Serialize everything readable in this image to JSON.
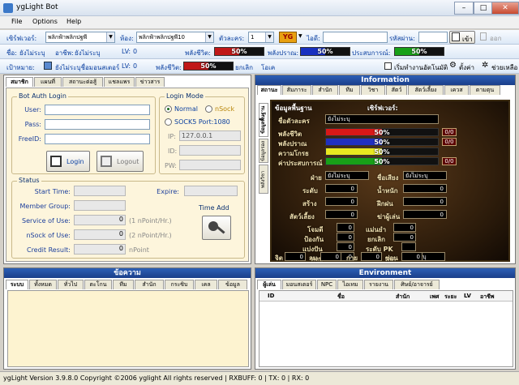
{
  "window": {
    "title": "ygLight Bot"
  },
  "menu": [
    "File",
    "Options",
    "Help"
  ],
  "toolbar1": {
    "server_label": "เซิร์ฟเวอร์:",
    "server_value": "พลิกฟ้าพลิกปฐพี",
    "room_label": "ห้อง:",
    "room_value": "พลิกฟ้าพลิกปฐพี10",
    "char_label": "ตัวละคร:",
    "char_value": "1",
    "yg_logo": "YG",
    "id_label": "ไอดี:",
    "id_value": "",
    "pass_label": "รหัสผ่าน:",
    "pass_value": "",
    "login_label": "เข้า",
    "logout_label": "ออก"
  },
  "toolbar2": {
    "name_label": "ชื่อ:",
    "name_value": "ยังไม่ระบุ",
    "job_label": "อาชีพ:",
    "job_value": "ยังไม่ระบุ",
    "lv_label": "LV:",
    "lv_value": "0",
    "hp_label": "พลังชีวิต:",
    "hp_text": "50%",
    "hp_percent": 50,
    "mp_label": "พลังปราณ:",
    "mp_text": "50%",
    "mp_percent": 50,
    "exp_label": "ประสบการณ์:",
    "exp_text": "50%",
    "exp_percent": 50
  },
  "toolbar3": {
    "target_label": "เป้าหมาย:",
    "target_value": "ยังไม่ระบุชื่อมอนสเตอร์",
    "lv_label": "LV:",
    "lv_value": "0",
    "hp_label": "พลังชีวิต:",
    "hp_text": "50%",
    "hp_percent": 50,
    "cancel_label": "ยกเลิก",
    "auto_label": "โอเค",
    "start_label": "เริ่มทำงานอัตโนมัติ",
    "settings_label": "ตั้งค่า",
    "help_label": "ช่วยเหลือ"
  },
  "left_tabs": [
    "สมาชิก",
    "แผนที่",
    "สถานะต่อสู้",
    "แชลแพร",
    "ข่าวสาร"
  ],
  "bot_auth": {
    "title": "Bot Auth Login",
    "user_label": "User:",
    "pass_label": "Pass:",
    "freeid_label": "FreeID:",
    "login_btn": "Login",
    "logout_btn": "Logout"
  },
  "login_mode": {
    "title": "Login Mode",
    "normal": "Normal",
    "nsock": "nSock",
    "socks5": "SOCK5  Port:1080",
    "ip_label": "IP:",
    "ip_value": "127.0.0.1",
    "id_label": "ID:",
    "pw_label": "PW:"
  },
  "status": {
    "title": "Status",
    "start_label": "Start Time:",
    "expire_label": "Expire:",
    "group_label": "Member Group:",
    "service_label": "Service of Use:",
    "service_value": "0",
    "service_hint": "(1 nPoint/Hr.)",
    "nsock_label": "nSock of Use:",
    "nsock_value": "0",
    "nsock_hint": "(2 nPoint/Hr.)",
    "credit_label": "Credit Result:",
    "credit_value": "0",
    "credit_unit": "nPoint",
    "timeadd_label": "Time Add"
  },
  "info": {
    "header": "Information",
    "tabs": [
      "สถานะ",
      "สัมภาระ",
      "สำนัก",
      "ทีม",
      "วิชา",
      "สัตว์",
      "สัตว์เลี้ยง",
      "เควส",
      "ตามตุน"
    ],
    "side_tabs": [
      "ข้อมูลพื้นฐาน",
      "ข้อมูลรอง",
      "พลังวิชา"
    ],
    "panel_title": "ข้อมูลพื้นฐาน",
    "server_label": "เซิร์ฟเวอร์:",
    "char_name_label": "ชื่อตัวละคร",
    "char_name_value": "ยังไม่ระบุ",
    "bars": [
      {
        "label": "พลังชีวิต",
        "text": "50%",
        "percent": 50,
        "color": "#d81818",
        "count": "0/0"
      },
      {
        "label": "พลังปราณ",
        "text": "50%",
        "percent": 50,
        "color": "#2030c0",
        "count": "0/0"
      },
      {
        "label": "ความโกรธ",
        "text": "50%",
        "percent": 50,
        "color": "#e8e820",
        "count": ""
      },
      {
        "label": "ค่าประสบการณ์",
        "text": "50%",
        "percent": 50,
        "color": "#18a018",
        "count": "0/0"
      }
    ],
    "faction_label": "ฝ่าย",
    "faction_value": "ยังไม่ระบุ",
    "title_label": "ชื่อเสียง",
    "title_value": "ยังไม่ระบุ",
    "level_label": "ระดับ",
    "level_value": "0",
    "weight_label": "น้ำหนัก",
    "weight_value": "0",
    "str_label": "สร้าง",
    "str_value": "0",
    "skill_label": "ฝีกฝน",
    "skill_value": "0",
    "merit_label": "สัตว์เลี้ยง",
    "merit_value": "0",
    "kill_label": "ฆ่าผู้เล่น",
    "kill_value": "0",
    "atk_label": "โจมตี",
    "atk_value": "0",
    "def_label": "ป้องกัน",
    "def_value": "0",
    "dodge_label": "หลบ",
    "dodge_value": "0",
    "hit_label": "แม่นยำ",
    "hit_value": "0",
    "gold_label": "แบ่งปัน",
    "gold_value": "0",
    "crit_label": "ยกเลิก",
    "crit_value": "0",
    "pk_label": "ระดับ PK",
    "pk_value": "",
    "sex_label": "เพศ",
    "sex_value": "ยังไม่ระบุ",
    "bottom": [
      {
        "label": "จิต",
        "value": "0"
      },
      {
        "label": "ลม",
        "value": "0"
      },
      {
        "label": "กาย",
        "value": "0"
      },
      {
        "label": "ซ่อน",
        "value": "0"
      }
    ]
  },
  "messages": {
    "header": "ข้อความ",
    "tabs": [
      "ระบบ",
      "ทั้งหมด",
      "ทั่วไป",
      "ตะโกน",
      "ทีม",
      "สำนัก",
      "กระซิบ",
      "เคล",
      "ข้อมูล"
    ]
  },
  "environment": {
    "header": "Environment",
    "tabs": [
      "ผู้เล่น",
      "มอนสเตอร์",
      "NPC",
      "ไอเทม",
      "รายงาน",
      "ศิษย์/อาจารย์"
    ],
    "columns": [
      "ID",
      "ชื่อ",
      "สำนัก",
      "เพศ",
      "ระยะ",
      "LV",
      "อาชีพ"
    ]
  },
  "statusbar": {
    "text": "ygLight Version 3.9.8.0 Copyright ©2006 yglight All rights reserved  |  RXBUFF:  0  |  TX:  0  |  RX:  0"
  }
}
